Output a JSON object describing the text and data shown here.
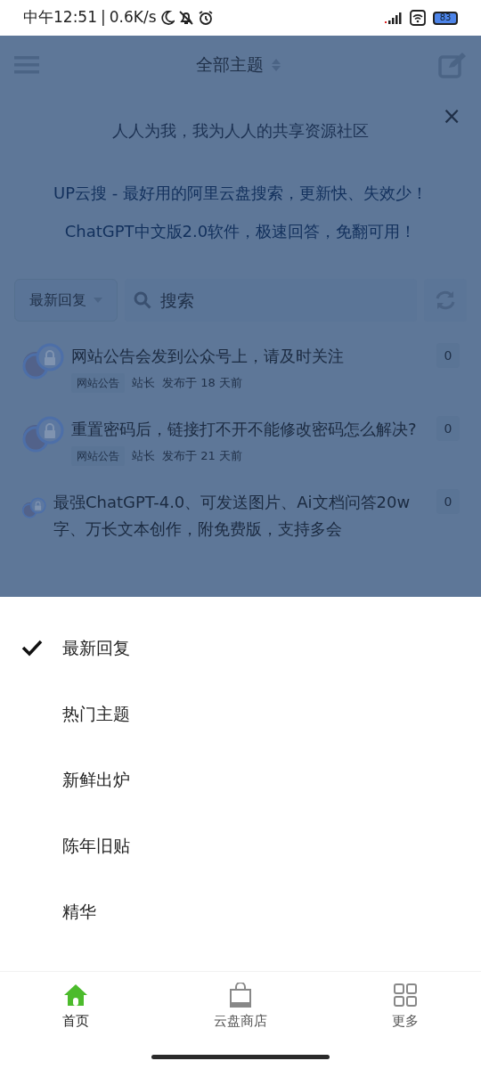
{
  "status_bar": {
    "time": "中午12:51",
    "separator": "|",
    "speed": "0.6K/s",
    "battery": "83"
  },
  "header": {
    "title": "全部主题"
  },
  "notice": {
    "text": "人人为我，我为人人的共享资源社区",
    "close": "×"
  },
  "promos": [
    "UP云搜 - 最好用的阿里云盘搜索，更新快、失效少！",
    "ChatGPT中文版2.0软件，极速回答，免翻可用！"
  ],
  "toolbar": {
    "sort": "最新回复",
    "search_placeholder": "搜索"
  },
  "topics": [
    {
      "title": "网站公告会发到公众号上，请及时关注",
      "tag": "网站公告",
      "author": "站长",
      "time": "发布于 18 天前",
      "replies": "0"
    },
    {
      "title": "重置密码后，链接打不开不能修改密码怎么解决?",
      "tag": "网站公告",
      "author": "站长",
      "time": "发布于 21 天前",
      "replies": "0"
    },
    {
      "title": "最强ChatGPT-4.0、可发送图片、Ai文档问答20w字、万长文本创作，附免费版，支持多会",
      "replies": "0"
    }
  ],
  "sort_menu": [
    {
      "label": "最新回复",
      "selected": true
    },
    {
      "label": "热门主题",
      "selected": false
    },
    {
      "label": "新鲜出炉",
      "selected": false
    },
    {
      "label": "陈年旧贴",
      "selected": false
    },
    {
      "label": "精华",
      "selected": false
    }
  ],
  "bottom_nav": [
    {
      "kind": "home",
      "label": "首页",
      "selected": true
    },
    {
      "kind": "shop",
      "label": "云盘商店",
      "selected": false
    },
    {
      "kind": "more",
      "label": "更多",
      "selected": false
    }
  ]
}
